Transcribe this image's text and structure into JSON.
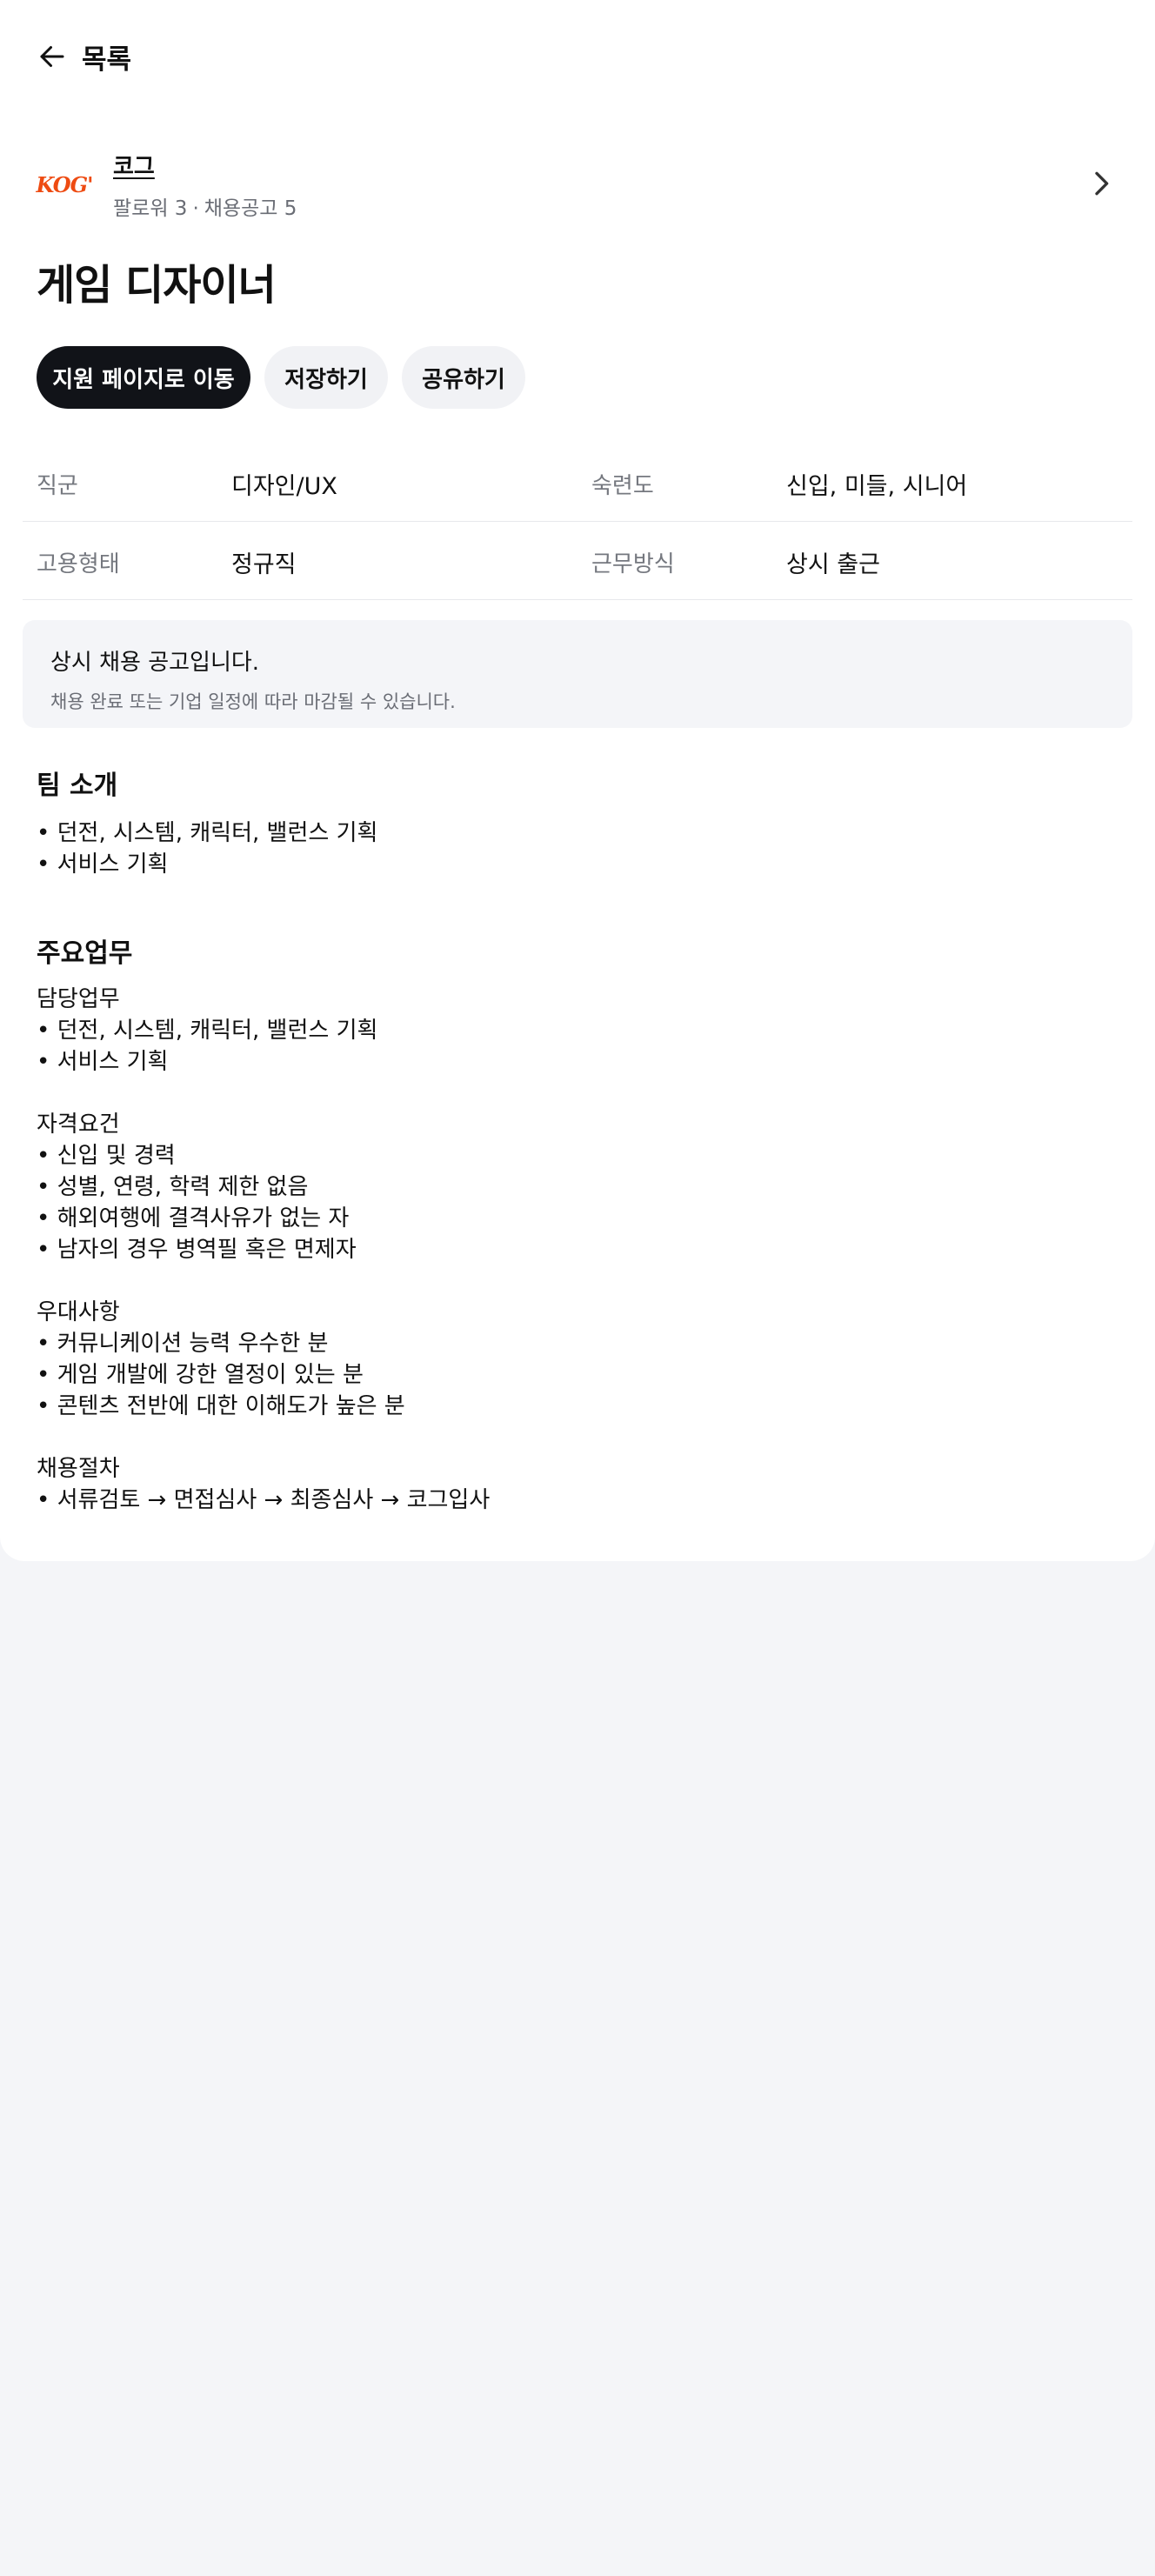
{
  "nav": {
    "back_label": "목록"
  },
  "company": {
    "logo_text": "KOG'",
    "name": "코그",
    "followers": "팔로워 3",
    "separator": "·",
    "postings": "채용공고 5"
  },
  "job": {
    "title": "게임 디자이너"
  },
  "actions": {
    "apply_label": "지원 페이지로 이동",
    "save_label": "저장하기",
    "share_label": "공유하기"
  },
  "info": {
    "job_group_label": "직군",
    "job_group_value": "디자인/UX",
    "level_label": "숙련도",
    "level_value": "신입, 미들, 시니어",
    "employment_label": "고용형태",
    "employment_value": "정규직",
    "work_label": "근무방식",
    "work_value": "상시 출근"
  },
  "notice": {
    "title": "상시 채용 공고입니다.",
    "subtitle": "채용 완료 또는 기업 일정에 따라 마감될 수 있습니다."
  },
  "team": {
    "heading": "팀 소개",
    "lines": [
      "• 던전, 시스템, 캐릭터, 밸런스 기획",
      "• 서비스 기획"
    ]
  },
  "duties": {
    "heading": "주요업무",
    "lines": [
      "담당업무",
      "• 던전, 시스템, 캐릭터, 밸런스 기획",
      "• 서비스 기획",
      "",
      "자격요건",
      "• 신입 및 경력",
      "• 성별, 연령, 학력 제한 없음",
      "• 해외여행에 결격사유가 없는 자",
      "• 남자의 경우 병역필 혹은 면제자",
      "",
      "우대사항",
      "• 커뮤니케이션 능력 우수한 분",
      "• 게임 개발에 강한 열정이 있는 분",
      "• 콘텐츠 전반에 대한 이해도가 높은 분",
      "",
      "채용절차",
      "• 서류검토 → 면접심사 → 최종심사 → 코그입사"
    ]
  },
  "colors": {
    "primary_button": "#111318",
    "logo": "#ee4b12",
    "muted_text": "#75787f",
    "page_bg": "#f4f5f8"
  },
  "icons": {
    "back": "arrow-left-icon",
    "company_link": "chevron-right-icon"
  }
}
